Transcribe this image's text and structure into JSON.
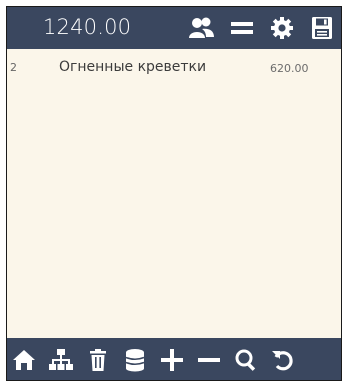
{
  "header": {
    "total": "1240.00",
    "icons": [
      "users-icon",
      "menu-icon",
      "settings-icon",
      "save-icon"
    ]
  },
  "order": {
    "items": [
      {
        "num": "2",
        "name": "Огненные креветки",
        "price": "620.00"
      }
    ]
  },
  "toolbar": {
    "icons": [
      "home-icon",
      "hierarchy-icon",
      "trash-icon",
      "database-icon",
      "plus-icon",
      "minus-icon",
      "search-icon",
      "refresh-icon"
    ]
  },
  "colors": {
    "bar": "#3a475f",
    "background": "#fbf6ea",
    "icon": "#ffffff"
  }
}
